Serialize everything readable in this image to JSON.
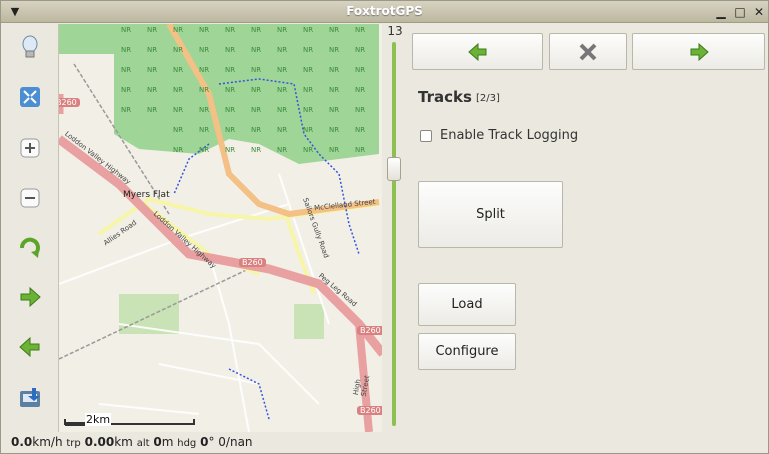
{
  "window": {
    "title": "FoxtrotGPS"
  },
  "toolbar": {
    "items": [
      {
        "icon": "lightbulb-icon"
      },
      {
        "icon": "fullscreen-icon"
      },
      {
        "icon": "zoom-in-icon"
      },
      {
        "icon": "zoom-out-icon"
      },
      {
        "icon": "rotate-icon"
      },
      {
        "icon": "forward-arrow-icon"
      },
      {
        "icon": "back-arrow-icon"
      },
      {
        "icon": "save-icon"
      }
    ]
  },
  "map": {
    "places": [
      "Myers Flat",
      "Allies Road",
      "Loddon Valley Highway",
      "Loddon Valley Highway",
      "McClelland Street",
      "Sailors Gully Road",
      "Peg Leg Road",
      "High Street"
    ],
    "shields": [
      "B260",
      "B260",
      "B260",
      "B260"
    ],
    "scale_label": "2km",
    "nr_label": "NR"
  },
  "zoom": {
    "level": "13"
  },
  "panel": {
    "nav_back_icon": "back-arrow-icon",
    "nav_close_icon": "close-icon",
    "nav_forward_icon": "forward-arrow-icon",
    "title": "Tracks",
    "count": "[2/3]",
    "enable_logging_label": "Enable Track Logging",
    "split_label": "Split",
    "load_label": "Load",
    "configure_label": "Configure"
  },
  "status": {
    "speed": "0.0",
    "speed_unit": "km/h",
    "trp_label": "trp",
    "trp": "0.00",
    "trp_unit": "km",
    "alt_label": "alt",
    "alt": "0",
    "alt_unit": "m",
    "hdg_label": "hdg",
    "hdg": "0",
    "hdg_unit": "°",
    "extra": "0/nan"
  },
  "colors": {
    "accent_green": "#5da42b",
    "major_road": "#e8a0a0",
    "park": "#9fd597"
  }
}
